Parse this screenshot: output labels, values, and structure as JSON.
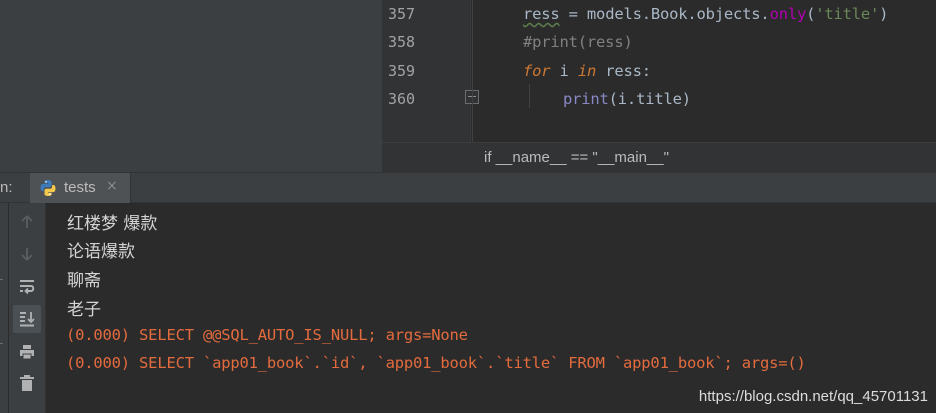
{
  "editor": {
    "line_numbers": [
      "357",
      "358",
      "359",
      "360"
    ],
    "lines": {
      "l357": {
        "var": "ress",
        "assign": " = models.Book.objects.",
        "method": "only",
        "open": "(",
        "arg": "'title'",
        "close": ")"
      },
      "l358": {
        "comment": "#print(ress)"
      },
      "l359": {
        "kw_for": "for",
        "mid1": " i ",
        "kw_in": "in",
        "mid2": " ress:"
      },
      "l360": {
        "builtin": "print",
        "rest": "(i.title)"
      }
    },
    "breadcrumb": "if __name__ == \"__main__\""
  },
  "run_window": {
    "label": "n:",
    "tab": {
      "label": "tests",
      "icon": "python-icon",
      "close_glyph": "×"
    },
    "toolbar": [
      {
        "name": "scroll-up-icon"
      },
      {
        "name": "scroll-down-icon"
      },
      {
        "name": "soft-wrap-icon"
      },
      {
        "name": "scroll-to-end-icon",
        "active": true
      },
      {
        "name": "print-icon"
      },
      {
        "name": "trash-icon"
      }
    ],
    "output": [
      "红楼梦 爆款",
      "论语爆款",
      "聊斋",
      "老子"
    ],
    "sql": [
      "(0.000) SELECT @@SQL_AUTO_IS_NULL; args=None",
      "(0.000) SELECT `app01_book`.`id`, `app01_book`.`title` FROM `app01_book`; args=()"
    ]
  },
  "watermark": "https://blog.csdn.net/qq_45701131",
  "colors": {
    "background": "#2b2b2b",
    "panel": "#3c3f41",
    "keyword": "#cc7832",
    "string": "#6a8759",
    "comment": "#808080",
    "builtin": "#8888c6",
    "method": "#b200b2",
    "stderr": "#e36b3e"
  }
}
